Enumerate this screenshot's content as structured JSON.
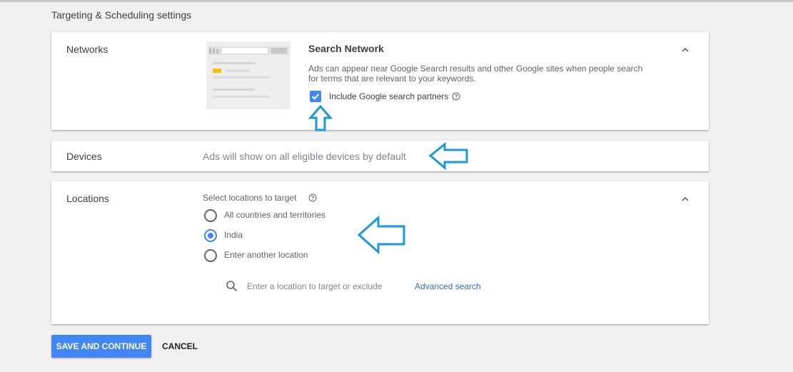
{
  "page": {
    "title": "Targeting & Scheduling settings"
  },
  "networks": {
    "label": "Networks",
    "search_network": {
      "title": "Search Network",
      "description": "Ads can appear near Google Search results and other Google sites when people search for terms that are relevant to your keywords.",
      "partners": {
        "label": "Include Google search partners",
        "checked": true
      }
    },
    "collapse_icon": "chevron-up-icon"
  },
  "devices": {
    "label": "Devices",
    "text": "Ads will show on all eligible devices by default"
  },
  "locations": {
    "label": "Locations",
    "subtitle": "Select locations to target",
    "options": [
      {
        "label": "All countries and territories",
        "selected": false
      },
      {
        "label": "India",
        "selected": true
      },
      {
        "label": "Enter another location",
        "selected": false
      }
    ],
    "search": {
      "placeholder": "Enter a location to target or exclude",
      "value": ""
    },
    "advanced_search": "Advanced search",
    "collapse_icon": "chevron-up-icon"
  },
  "actions": {
    "save": "SAVE AND CONTINUE",
    "cancel": "CANCEL"
  },
  "colors": {
    "accent": "#4285f4",
    "annotation_arrow": "#1a9ad6",
    "illustration_highlight": "#fbbc04"
  }
}
